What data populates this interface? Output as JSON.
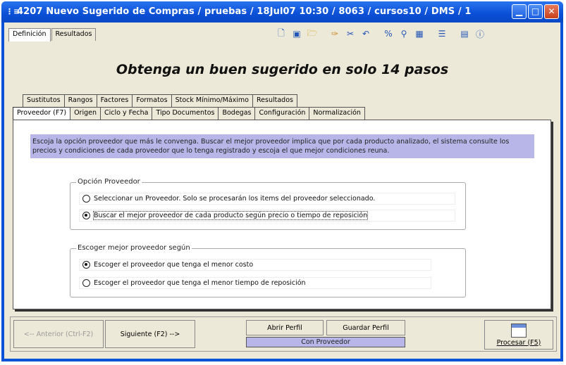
{
  "window": {
    "title": "4207 Nuevo Sugerido de Compras / pruebas / 18Jul07 10:30 / 8063 / cursos10 / DMS / 1",
    "minimize_icon": "minimize-icon",
    "maximize_icon": "maximize-icon",
    "close_icon": "close-icon"
  },
  "top_tabs": {
    "definicion": "Definición",
    "resultados": "Resultados"
  },
  "heading": "Obtenga un buen sugerido en solo 14 pasos",
  "tabs_back": [
    "Sustitutos",
    "Rangos",
    "Factores",
    "Formatos",
    "Stock Mínimo/Máximo",
    "Resultados"
  ],
  "tabs_front": [
    "Proveedor (F7)",
    "Origen",
    "Ciclo y Fecha",
    "Tipo Documentos",
    "Bodegas",
    "Configuración",
    "Normalización"
  ],
  "info_text": "Escoja la opción proveedor que más le convenga.  Buscar el mejor proveedor implica que por cada producto analizado, el sistema consulte los precios y condiciones de cada proveedor que lo tenga registrado y escoja el que mejor condiciones reuna.",
  "group1": {
    "label": "Opción Proveedor",
    "options": [
      {
        "label": "Seleccionar un Proveedor.  Solo se procesarán los items del proveedor seleccionado.",
        "selected": false
      },
      {
        "label": "Buscar el mejor proveedor de cada producto según precio o tiempo de reposición",
        "selected": true
      }
    ]
  },
  "group2": {
    "label": "Escoger mejor proveedor según",
    "options": [
      {
        "label": "Escoger el proveedor que tenga el menor costo",
        "selected": true
      },
      {
        "label": "Escoger el proveedor que tenga el menor tiempo de reposición",
        "selected": false
      }
    ]
  },
  "buttons": {
    "anterior": "<-- Anterior (Ctrl-F2)",
    "siguiente": "Siguiente (F2) -->",
    "abrir_perfil": "Abrir Perfil",
    "guardar_perfil": "Guardar Perfil",
    "procesar": "Procesar (F5)"
  },
  "status_text": "Con Proveedor",
  "colors": {
    "titlebar": "#0a52d8",
    "info_bg": "#b8b6e8",
    "client_bg": "#ece9d8"
  }
}
